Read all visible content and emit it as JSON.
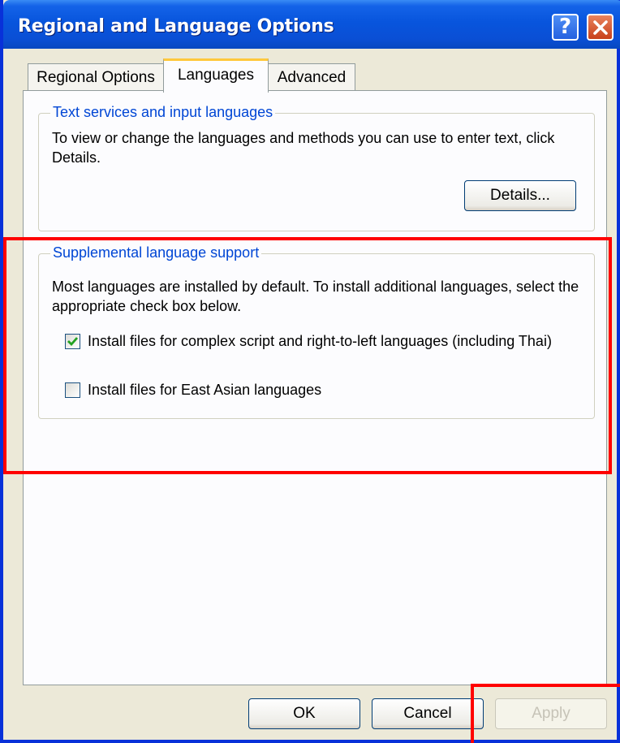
{
  "window": {
    "title": "Regional and Language Options"
  },
  "tabs": [
    {
      "label": "Regional Options",
      "active": false
    },
    {
      "label": "Languages",
      "active": true
    },
    {
      "label": "Advanced",
      "active": false
    }
  ],
  "text_services": {
    "legend": "Text services and input languages",
    "description": "To view or change the languages and methods you can use to enter text, click Details.",
    "details_button": "Details..."
  },
  "supplemental": {
    "legend": "Supplemental language support",
    "description": "Most languages are installed by default. To install additional languages, select the appropriate check box below.",
    "checkboxes": [
      {
        "label": "Install files for complex script and right-to-left languages (including Thai)",
        "checked": true
      },
      {
        "label": "Install files for East Asian languages",
        "checked": false
      }
    ]
  },
  "footer": {
    "ok_label": "OK",
    "cancel_label": "Cancel",
    "apply_label": "Apply",
    "apply_enabled": false
  },
  "colors": {
    "highlight": "#ff0000",
    "title_bar": "#0a4fd5",
    "group_legend": "#0046d5"
  },
  "icons": [
    "help-icon",
    "close-icon",
    "checkmark-icon"
  ]
}
